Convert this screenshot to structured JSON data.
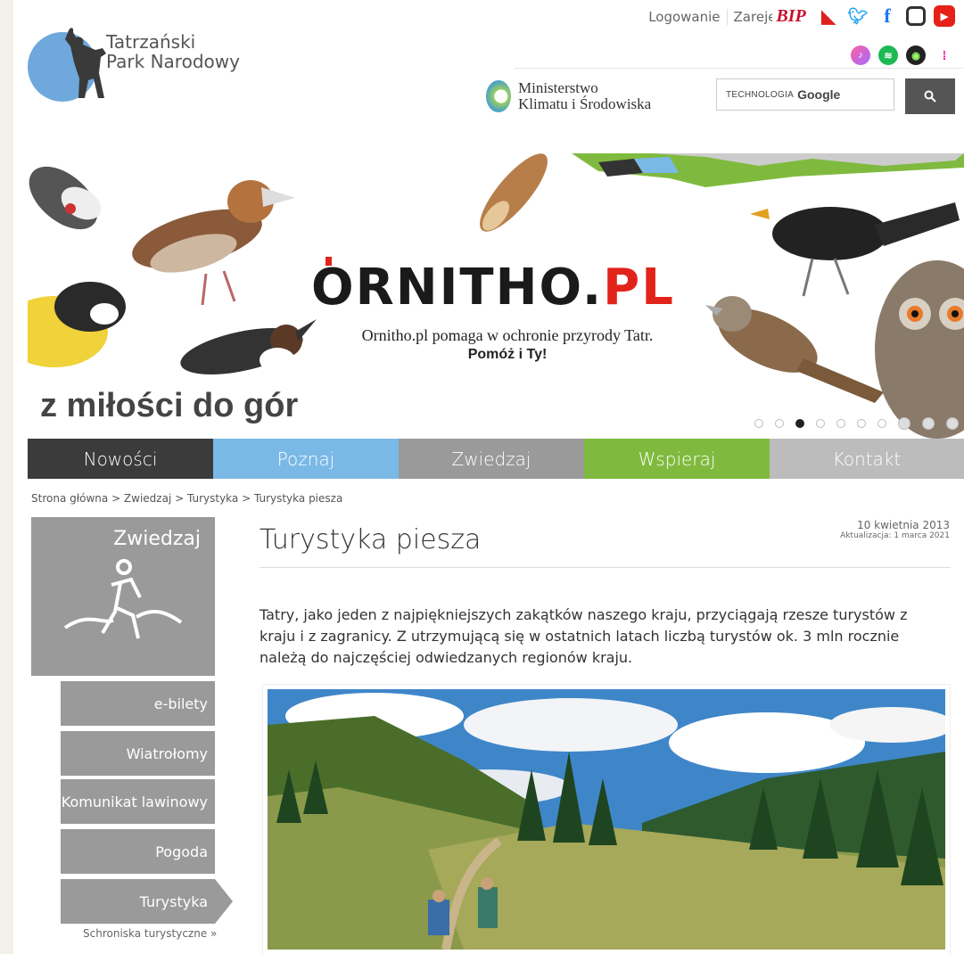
{
  "header": {
    "logo_line1": "Tatrzański",
    "logo_line2": "Park Narodowy",
    "login": "Logowanie",
    "register": "Zarejestruj",
    "bip": "BIP",
    "ministry_line1": "Ministerstwo",
    "ministry_line2": "Klimatu i Środowiska",
    "search_tech": "TECHNOLOGIA",
    "search_google": "Google",
    "search_button": "🔍"
  },
  "banner": {
    "logo_main": "ORNITHO.",
    "logo_pl": "PL",
    "subtitle": "Ornitho.pl pomaga w ochronie przyrody Tatr.",
    "subtitle_bold": "Pomóż i Ty!",
    "slogan": "z miłości do gór",
    "active_slide": 3,
    "slide_count": 10
  },
  "nav": {
    "items": [
      "Nowości",
      "Poznaj",
      "Zwiedzaj",
      "Wspieraj",
      "Kontakt"
    ]
  },
  "breadcrumb": "Strona główna > Zwiedzaj > Turystyka > Turystyka piesza",
  "sidebar": {
    "title": "Zwiedzaj",
    "items": [
      "e-bilety",
      "Wiatrołomy",
      "Komunikat lawinowy",
      "Pogoda",
      "Turystyka"
    ],
    "active": "Turystyka",
    "sub": "Schroniska turystyczne  »"
  },
  "content": {
    "title": "Turystyka piesza",
    "date": "10 kwietnia 2013",
    "updated": "Aktualizacja: 1 marca 2021",
    "lead": "Tatry, jako jeden z najpiękniejszych zakątków naszego kraju, przyciągają rzesze turystów z kraju i z zagranicy. Z utrzymującą się w ostatnich latach liczbą turystów ok. 3 mln rocznie należą do najczęściej odwiedzanych regionów kraju."
  },
  "colors": {
    "nav_nowosci": "#3b3b3b",
    "nav_poznaj": "#7ab8e6",
    "nav_zwiedzaj": "#9a9a9a",
    "nav_wspieraj": "#7fba3e",
    "nav_kontakt": "#bcbcbc",
    "ornitho_red": "#e2231a"
  }
}
